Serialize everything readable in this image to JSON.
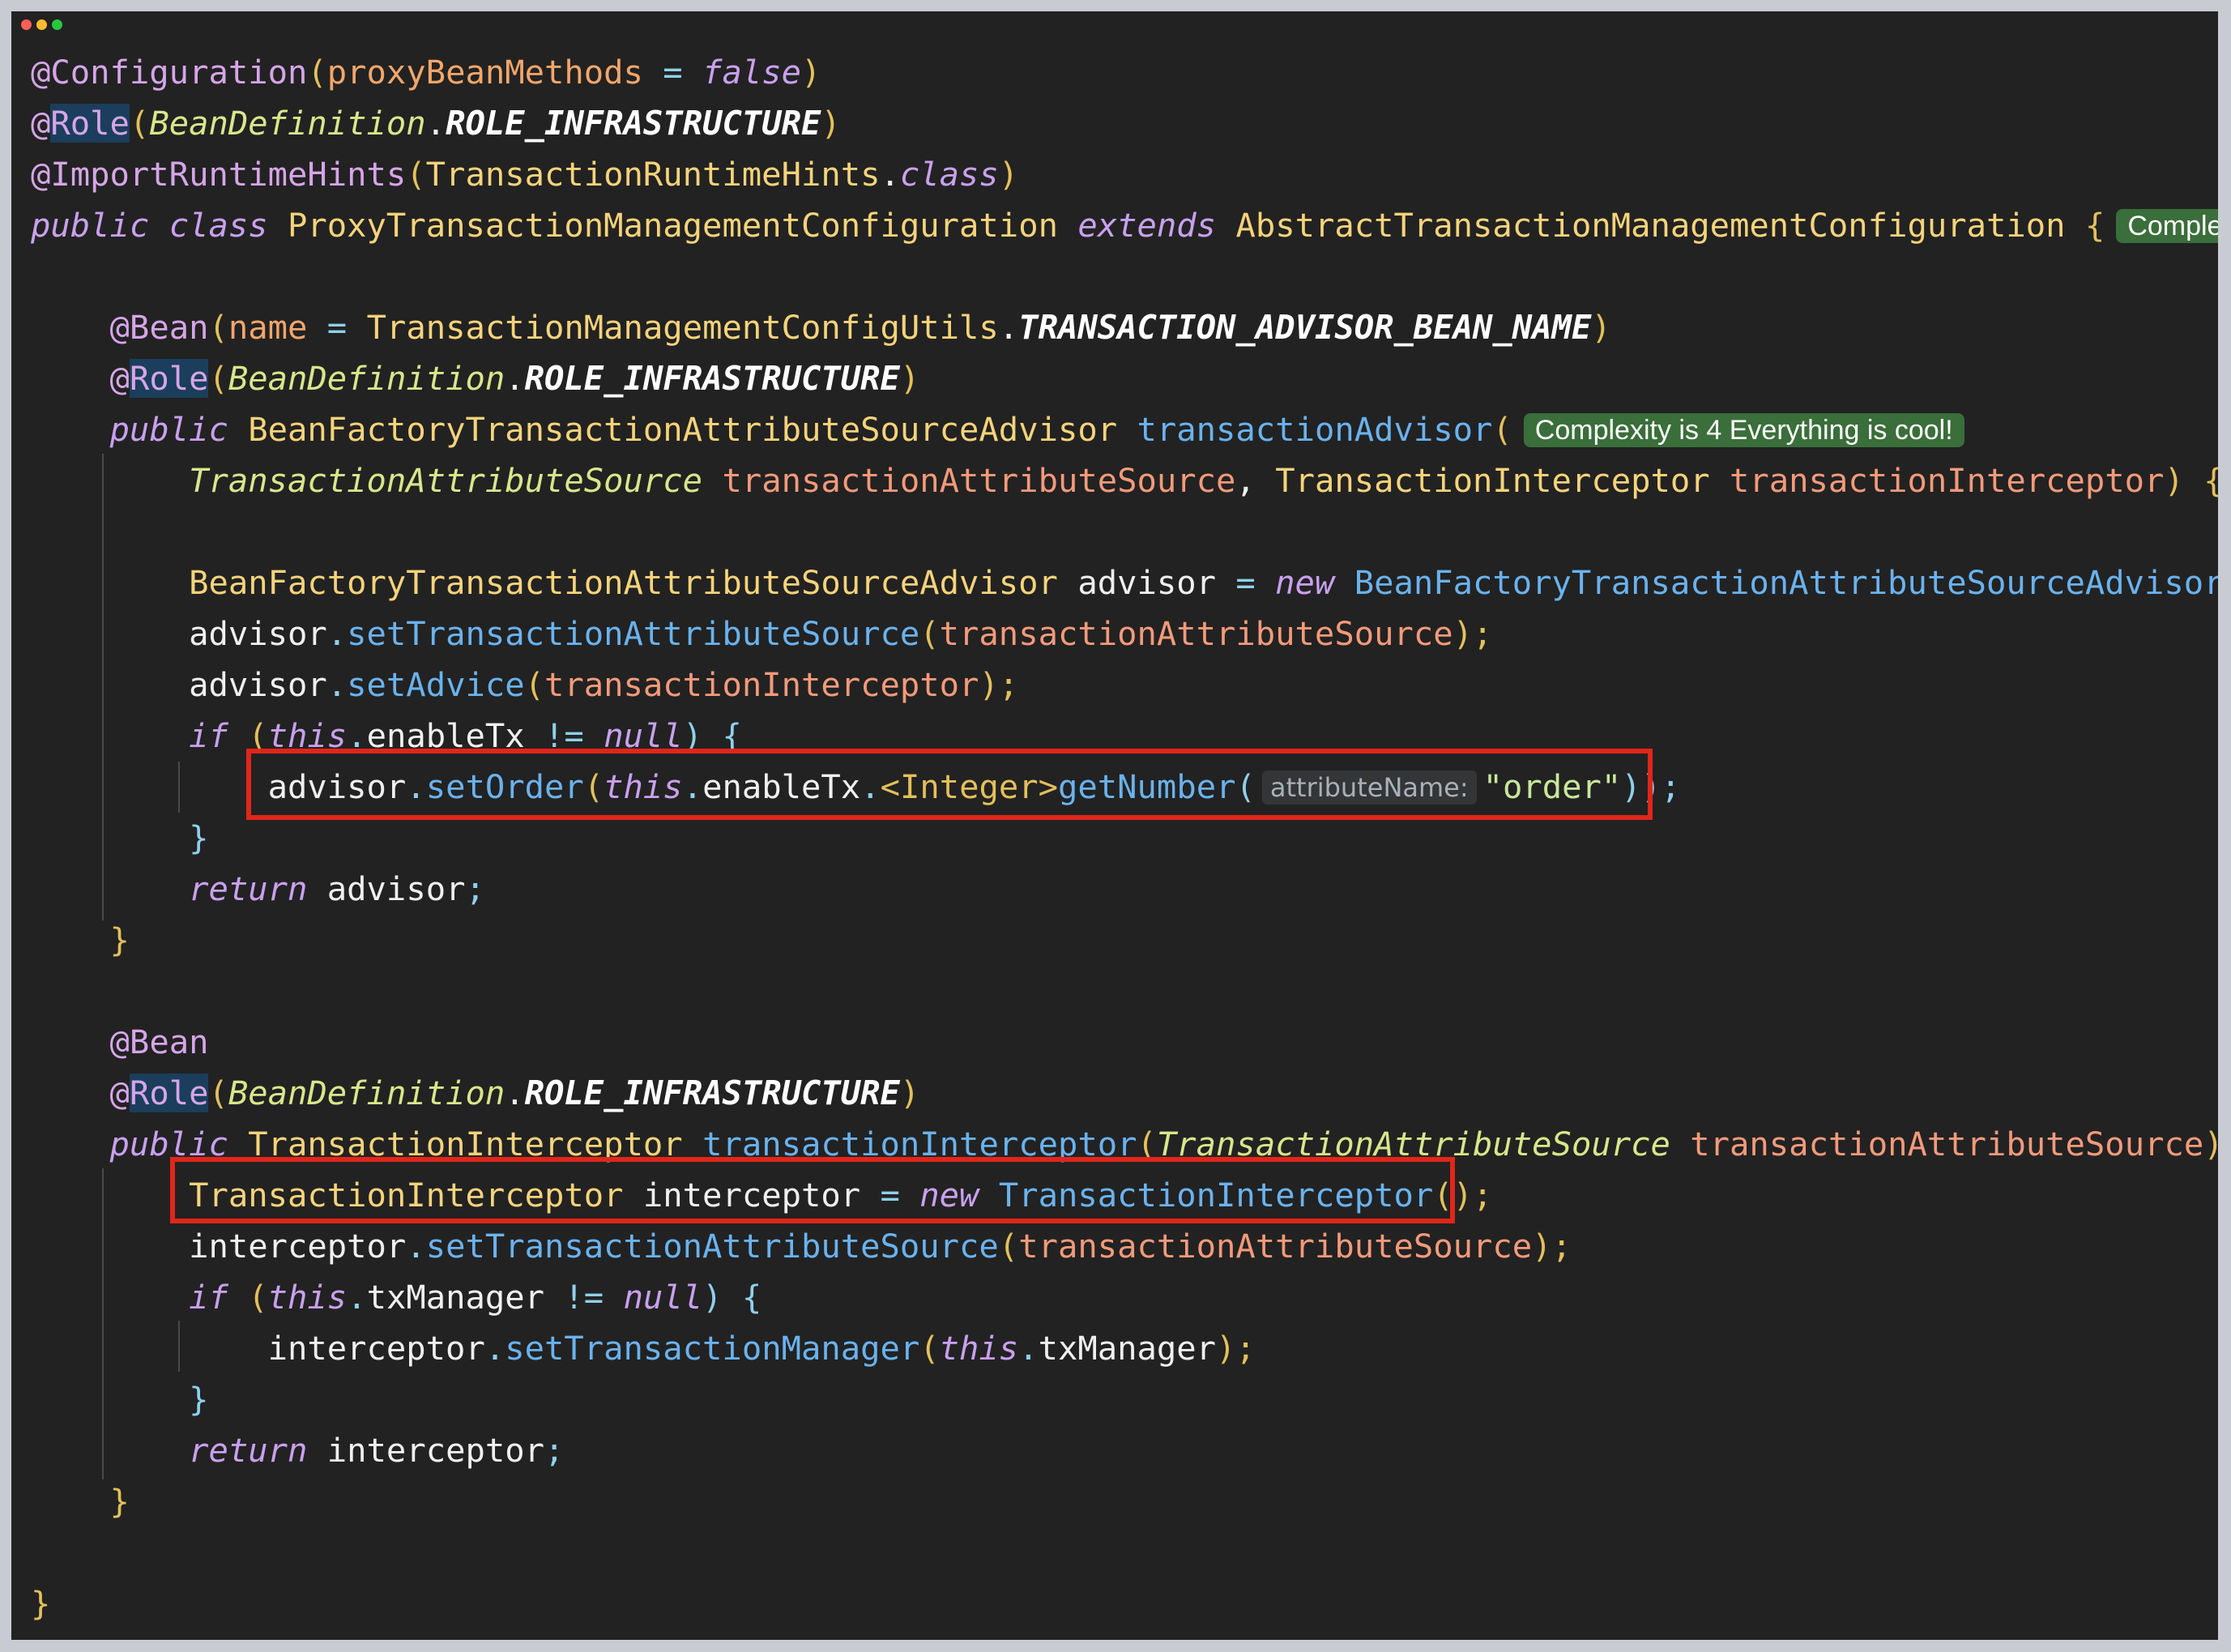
{
  "window": {
    "traffic_lights": [
      "#ff5f57",
      "#febc2e",
      "#28c840"
    ]
  },
  "code": {
    "l1_ann": "@Configuration",
    "l1_open": "(",
    "l1_attr": "proxyBeanMethods",
    "l1_eq": " = ",
    "l1_false": "false",
    "l1_close": ")",
    "l2_at": "@",
    "l2_role": "Role",
    "l2_open": "(",
    "l2_type": "BeanDefinition",
    "l2_dot": ".",
    "l2_const": "ROLE_INFRASTRUCTURE",
    "l2_close": ")",
    "l3_ann": "@ImportRuntimeHints",
    "l3_open": "(",
    "l3_cls": "TransactionRuntimeHints",
    "l3_dot": ".",
    "l3_kw": "class",
    "l3_close": ")",
    "l4_public": "public",
    "l4_class": "class",
    "l4_name": "ProxyTransactionManagementConfiguration",
    "l4_extends": "extends",
    "l4_super": "AbstractTransactionManagementConfiguration",
    "l4_brace": "{",
    "l4_badge": "Complexity i",
    "l6_ann": "@Bean",
    "l6_open": "(",
    "l6_attr": "name",
    "l6_eq": " = ",
    "l6_cls": "TransactionManagementConfigUtils",
    "l6_dot": ".",
    "l6_const": "TRANSACTION_ADVISOR_BEAN_NAME",
    "l6_close": ")",
    "l7_at": "@",
    "l7_role": "Role",
    "l7_open": "(",
    "l7_type": "BeanDefinition",
    "l7_dot": ".",
    "l7_const": "ROLE_INFRASTRUCTURE",
    "l7_close": ")",
    "l8_public": "public",
    "l8_ret": "BeanFactoryTransactionAttributeSourceAdvisor",
    "l8_method": "transactionAdvisor",
    "l8_open": "(",
    "l8_badge": "Complexity is 4 Everything is cool!",
    "l9_type1": "TransactionAttributeSource",
    "l9_param1": "transactionAttributeSource",
    "l9_comma": ", ",
    "l9_type2": "TransactionInterceptor",
    "l9_param2": "transactionInterceptor",
    "l9_close": ") {",
    "l11_type": "BeanFactoryTransactionAttributeSourceAdvisor",
    "l11_var": "advisor",
    "l11_eq": " = ",
    "l11_new": "new",
    "l11_ctor": "BeanFactoryTransactionAttributeSourceAdvisor",
    "l11_end": "();",
    "l12_var": "advisor",
    "l12_dot": ".",
    "l12_method": "setTransactionAttributeSource",
    "l12_open": "(",
    "l12_arg": "transactionAttributeSource",
    "l12_end": ");",
    "l13_var": "advisor",
    "l13_dot": ".",
    "l13_method": "setAdvice",
    "l13_open": "(",
    "l13_arg": "transactionInterceptor",
    "l13_end": ");",
    "l14_if": "if",
    "l14_open": " (",
    "l14_this": "this",
    "l14_dot": ".",
    "l14_field": "enableTx",
    "l14_ne": " != ",
    "l14_null": "null",
    "l14_end": ") {",
    "l15_var": "advisor",
    "l15_dot": ".",
    "l15_method": "setOrder",
    "l15_open": "(",
    "l15_this": "this",
    "l15_dot2": ".",
    "l15_field": "enableTx",
    "l15_dot3": ".",
    "l15_generic": "<Integer>",
    "l15_method2": "getNumber",
    "l15_open2": "(",
    "l15_hint": "attributeName:",
    "l15_str": "\"order\"",
    "l15_end": "));",
    "l16_brace": "}",
    "l17_return": "return",
    "l17_var": "advisor",
    "l17_semi": ";",
    "l18_brace": "}",
    "l20_ann": "@Bean",
    "l21_at": "@",
    "l21_role": "Role",
    "l21_open": "(",
    "l21_type": "BeanDefinition",
    "l21_dot": ".",
    "l21_const": "ROLE_INFRASTRUCTURE",
    "l21_close": ")",
    "l22_public": "public",
    "l22_ret": "TransactionInterceptor",
    "l22_method": "transactionInterceptor",
    "l22_open": "(",
    "l22_ptype": "TransactionAttributeSource",
    "l22_param": "transactionAttributeSource",
    "l22_end": ") {",
    "l23_type": "TransactionInterceptor",
    "l23_var": "interceptor",
    "l23_eq": " = ",
    "l23_new": "new",
    "l23_ctor": "TransactionInterceptor",
    "l23_end": "();",
    "l24_var": "interceptor",
    "l24_dot": ".",
    "l24_method": "setTransactionAttributeSource",
    "l24_open": "(",
    "l24_arg": "transactionAttributeSource",
    "l24_end": ");",
    "l25_if": "if",
    "l25_open": " (",
    "l25_this": "this",
    "l25_dot": ".",
    "l25_field": "txManager",
    "l25_ne": " != ",
    "l25_null": "null",
    "l25_end": ") {",
    "l26_var": "interceptor",
    "l26_dot": ".",
    "l26_method": "setTransactionManager",
    "l26_open": "(",
    "l26_this": "this",
    "l26_dot2": ".",
    "l26_field": "txManager",
    "l26_end": ");",
    "l27_brace": "}",
    "l28_return": "return",
    "l28_var": "interceptor",
    "l28_semi": ";",
    "l29_brace": "}",
    "l31_brace": "}"
  },
  "highlight_color": "#e0261a"
}
